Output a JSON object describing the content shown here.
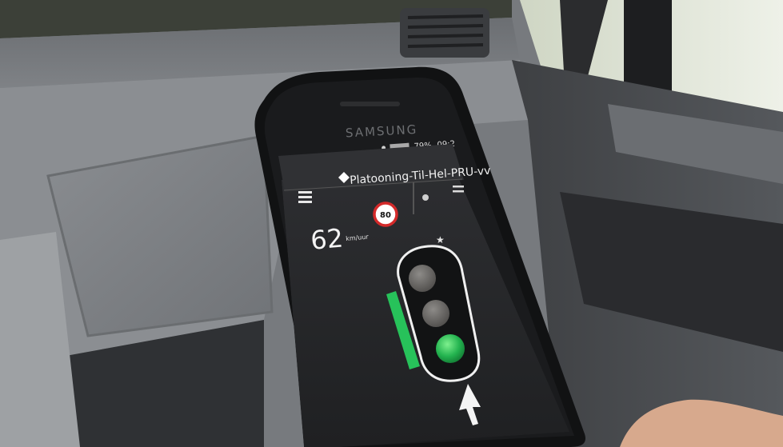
{
  "photo": {
    "subject": "smartphone",
    "setting": "vehicle cab interior"
  },
  "phone": {
    "brand": "SAMSUNG",
    "status_bar": {
      "battery": "79%",
      "clock": "09:2"
    }
  },
  "app": {
    "title": "Platooning-Til-Hel-PRU-vv",
    "menu_icon": "hamburger-menu-icon",
    "logo_icon": "diamond-route-icon",
    "speed": {
      "value": "62",
      "unit": "km/uur"
    },
    "speed_limit": "80",
    "signal_state": "green",
    "lane_indicator": "vertical green bar",
    "direction_icon": "arrow-up-icon"
  },
  "colors": {
    "signal_green": "#27c25a",
    "limit_red": "#d42a2a",
    "app_background": "#2a2a2c"
  }
}
